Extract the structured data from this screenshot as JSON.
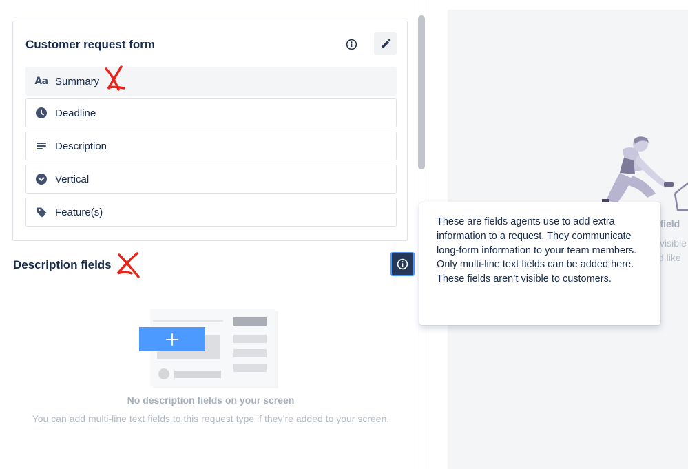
{
  "form_card": {
    "title": "Customer request form",
    "fields": [
      {
        "label": "Summary",
        "icon": "text-aa-icon"
      },
      {
        "label": "Deadline",
        "icon": "clock-icon"
      },
      {
        "label": "Description",
        "icon": "lines-icon"
      },
      {
        "label": "Vertical",
        "icon": "chevron-circle-icon"
      },
      {
        "label": "Feature(s)",
        "icon": "tag-icon"
      }
    ],
    "summary_icon_text": "Aa"
  },
  "description_section": {
    "title": "Description fields",
    "empty_title": "No description fields on your screen",
    "empty_text": "You can add multi-line text fields to this request type if they’re added to your screen."
  },
  "tooltip": {
    "paragraph1": "These are fields agents use to add extra information to a request. They communicate long-form information to your team members.",
    "paragraph2": "Only multi-line text fields can be added here. These fields aren’t visible to customers."
  },
  "right_panel_partial": {
    "line1": "n field",
    "line2": "visible",
    "line3": "d like"
  },
  "colors": {
    "annotation_red": "#e8231a",
    "primary_blue": "#4c9aff",
    "dark_navy": "#253858",
    "icon_gray": "#42526e"
  }
}
